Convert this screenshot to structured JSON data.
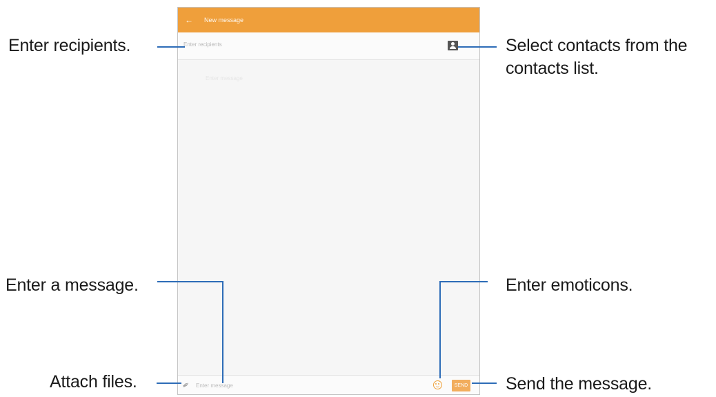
{
  "screen": {
    "appbar": {
      "back_icon": "←",
      "title": "New message"
    },
    "recipients": {
      "placeholder": "Enter recipients"
    },
    "thread_hint": "Enter message",
    "compose": {
      "message_placeholder": "Enter message",
      "send_label": "SEND"
    }
  },
  "annotations": {
    "enter_recipients": "Enter recipients.",
    "select_contacts_line1": "Select contacts from the",
    "select_contacts_line2": "contacts list.",
    "enter_message": "Enter a message.",
    "enter_emoticons": "Enter emoticons.",
    "attach_files": "Attach files.",
    "send_message": "Send the message."
  },
  "colors": {
    "appbar": "#ef9f3b",
    "callout_line": "#2d6cb7",
    "send_button": "#f2a54c",
    "emoticon": "#efa23b"
  },
  "icons": [
    "back-arrow-icon",
    "contacts-icon",
    "attach-icon",
    "emoticon-icon"
  ]
}
